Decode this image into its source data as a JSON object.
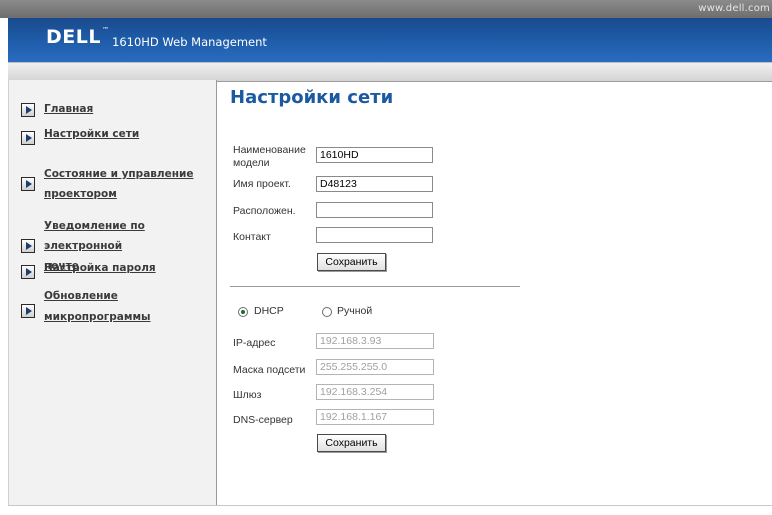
{
  "top": {
    "url": "www.dell.com"
  },
  "banner": {
    "logo": "DELL",
    "tm": "™",
    "title": "1610HD Web Management"
  },
  "sidebar": {
    "items": [
      {
        "label_lines": [
          "Главная"
        ]
      },
      {
        "label_lines": [
          "Настройки сети"
        ]
      },
      {
        "label_lines": [
          "Состояние и управление",
          "проектором"
        ]
      },
      {
        "label_lines": [
          "Уведомление по электронной",
          "почте"
        ]
      },
      {
        "label_lines": [
          "Настройка пароля"
        ]
      },
      {
        "label_lines": [
          "Обновление микропрограммы"
        ]
      }
    ]
  },
  "main": {
    "title": "Настройки сети",
    "projector_info": {
      "model_name_label": [
        "Наименование",
        "модели"
      ],
      "model_name_value": "1610HD",
      "projector_name_label": "Имя проект.",
      "projector_name_value": "D48123",
      "location_label": "Расположен.",
      "location_value": "",
      "contact_label": "Контакт",
      "contact_value": "",
      "save_label": "Сохранить"
    },
    "network": {
      "mode_selected": "DHCP",
      "dhcp_label": "DHCP",
      "manual_label": "Ручной",
      "ip_label": "IP-адрес",
      "ip_value": "192.168.3.93",
      "mask_label": "Маска подсети",
      "mask_value": "255.255.255.0",
      "gateway_label": "Шлюз",
      "gateway_value": "192.168.3.254",
      "dns_label": "DNS-сервер",
      "dns_value": "192.168.1.167",
      "save_label": "Сохранить"
    }
  }
}
